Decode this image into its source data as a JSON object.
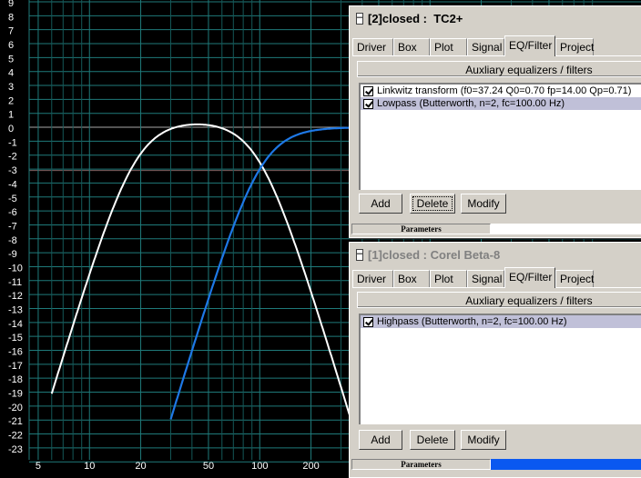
{
  "plot": {
    "y_ticks": [
      "9",
      "8",
      "7",
      "6",
      "5",
      "4",
      "3",
      "2",
      "1",
      "0",
      "-1",
      "-2",
      "-3",
      "-4",
      "-5",
      "-6",
      "-7",
      "-8",
      "-9",
      "-10",
      "-11",
      "-12",
      "-13",
      "-14",
      "-15",
      "-16",
      "-17",
      "-18",
      "-19",
      "-20",
      "-21",
      "-22",
      "-23"
    ],
    "x_ticks": [
      "5",
      "10",
      "20",
      "50",
      "100",
      "200"
    ],
    "colors": {
      "background": "#000000",
      "grid": "#1f7a7a",
      "grid_minor": "#145858",
      "zero_line": "#a8a8a8",
      "ref_line": "#806060",
      "white_curve": "#ffffff",
      "blue_curve": "#1e78e6"
    }
  },
  "window_tc2": {
    "title": "[2]closed :  TC2+",
    "tabs": [
      "Driver",
      "Box",
      "Plot",
      "Signal",
      "EQ/Filter",
      "Project"
    ],
    "active_tab": "EQ/Filter",
    "section_label": "Auxliary equalizers / filters",
    "filters": [
      {
        "checked": true,
        "label": "Linkwitz transform (f0=37.24 Q0=0.70 fp=14.00 Qp=0.71)"
      },
      {
        "checked": true,
        "label": "Lowpass (Butterworth, n=2, fc=100.00 Hz)"
      }
    ],
    "buttons": {
      "add": "Add",
      "delete": "Delete",
      "modify": "Modify"
    },
    "status_label": "Parameters"
  },
  "window_corel": {
    "title": "[1]closed : Corel Beta-8",
    "tabs": [
      "Driver",
      "Box",
      "Plot",
      "Signal",
      "EQ/Filter",
      "Project"
    ],
    "active_tab": "EQ/Filter",
    "section_label": "Auxliary equalizers / filters",
    "filters": [
      {
        "checked": true,
        "label": "Highpass (Butterworth, n=2, fc=100.00 Hz)"
      }
    ],
    "buttons": {
      "add": "Add",
      "delete": "Delete",
      "modify": "Modify"
    },
    "status_label": "Parameters"
  }
}
